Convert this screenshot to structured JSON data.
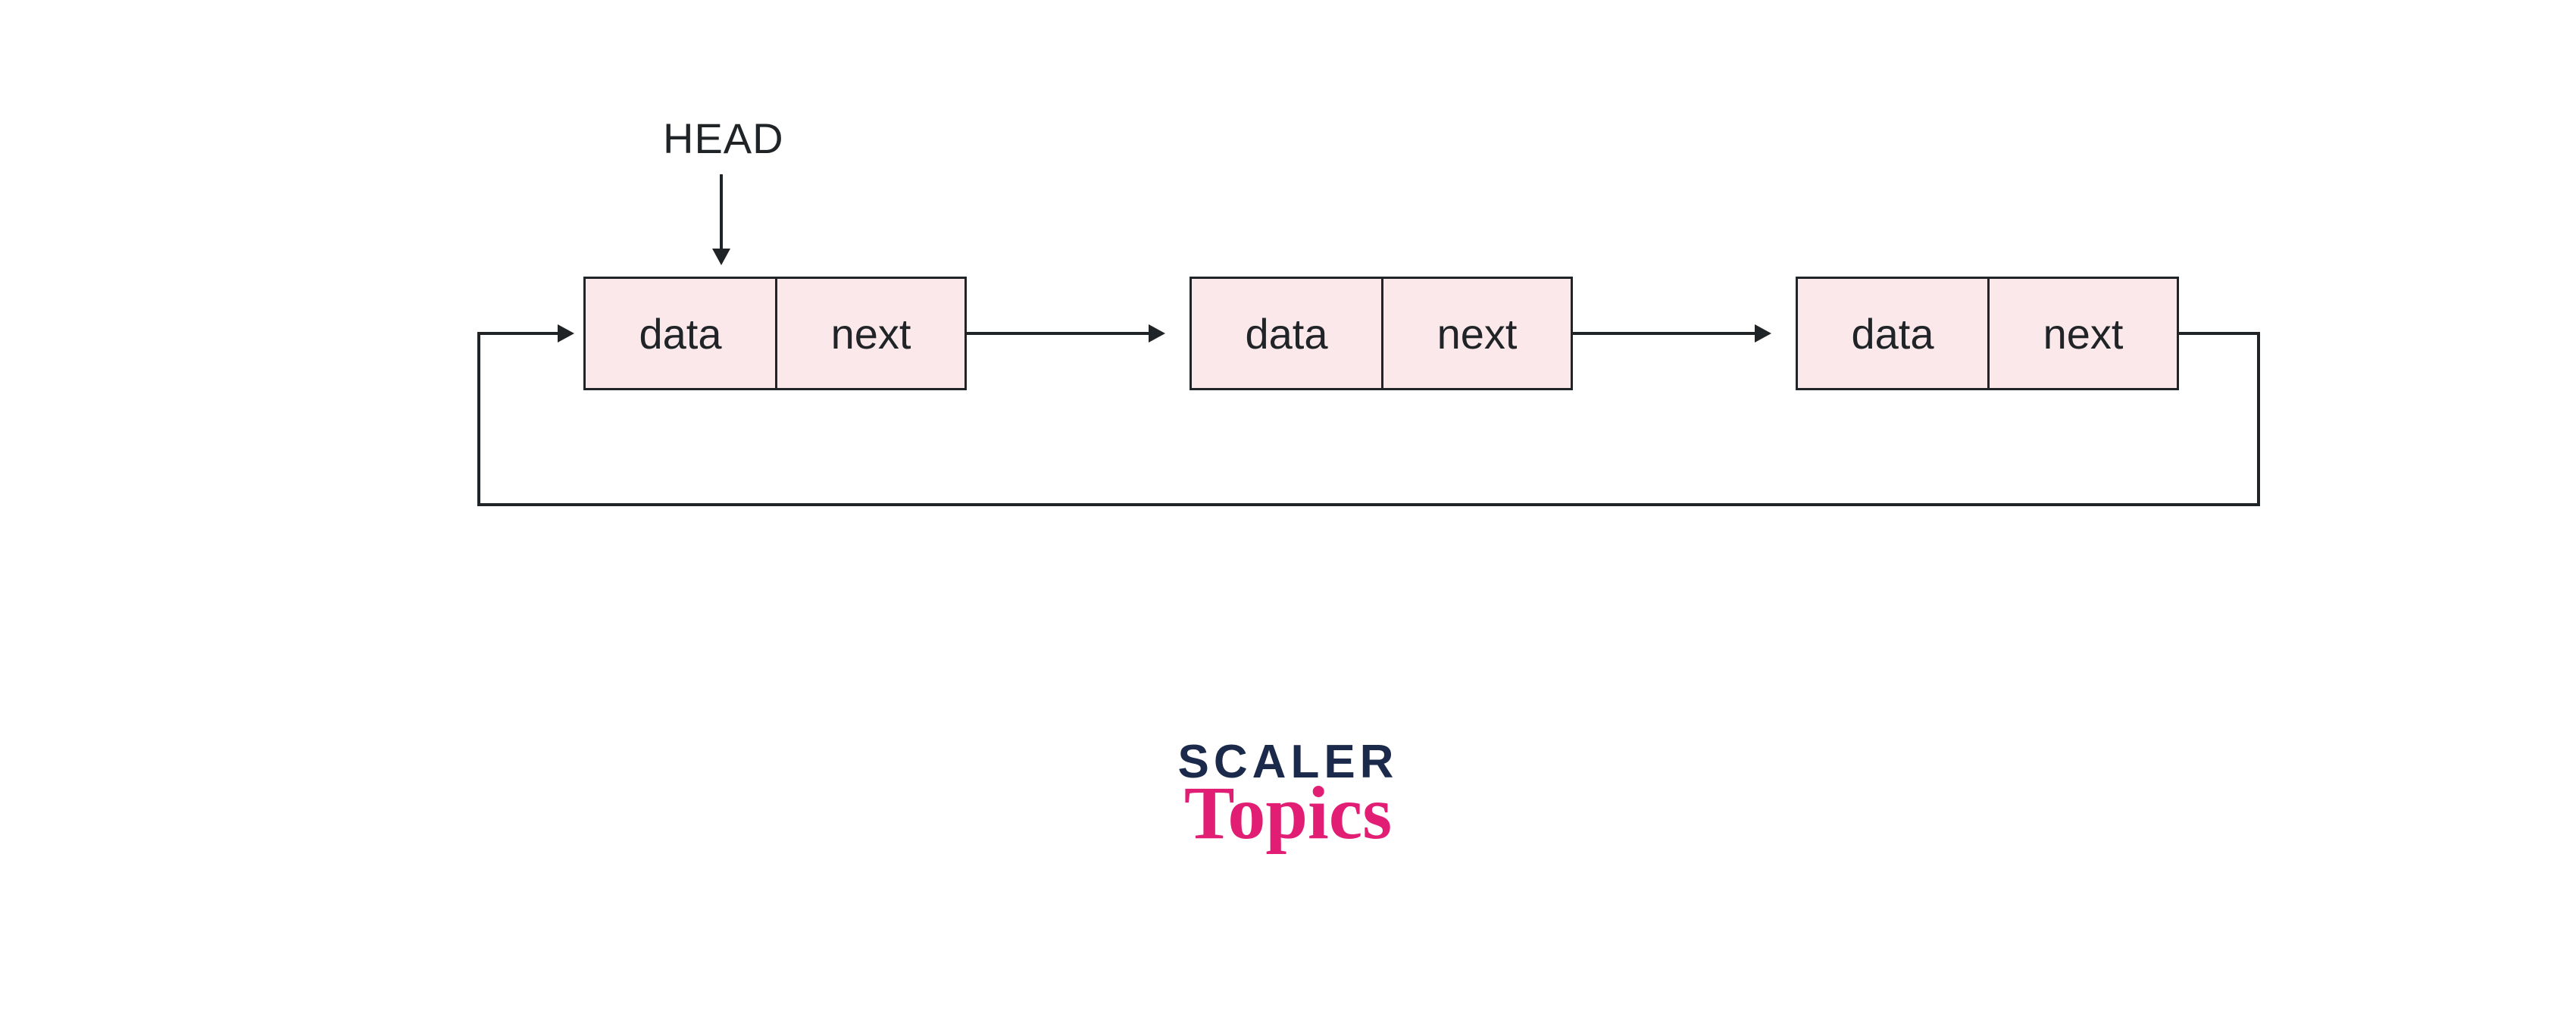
{
  "diagram": {
    "head_label": "HEAD",
    "nodes": [
      {
        "data": "data",
        "next": "next"
      },
      {
        "data": "data",
        "next": "next"
      },
      {
        "data": "data",
        "next": "next"
      }
    ]
  },
  "brand": {
    "line1": "SCALER",
    "line2": "Topics"
  },
  "colors": {
    "node_fill": "#fbe8eb",
    "stroke": "#212427",
    "brand_dark": "#1b2a4a",
    "brand_pink": "#e11d74"
  }
}
